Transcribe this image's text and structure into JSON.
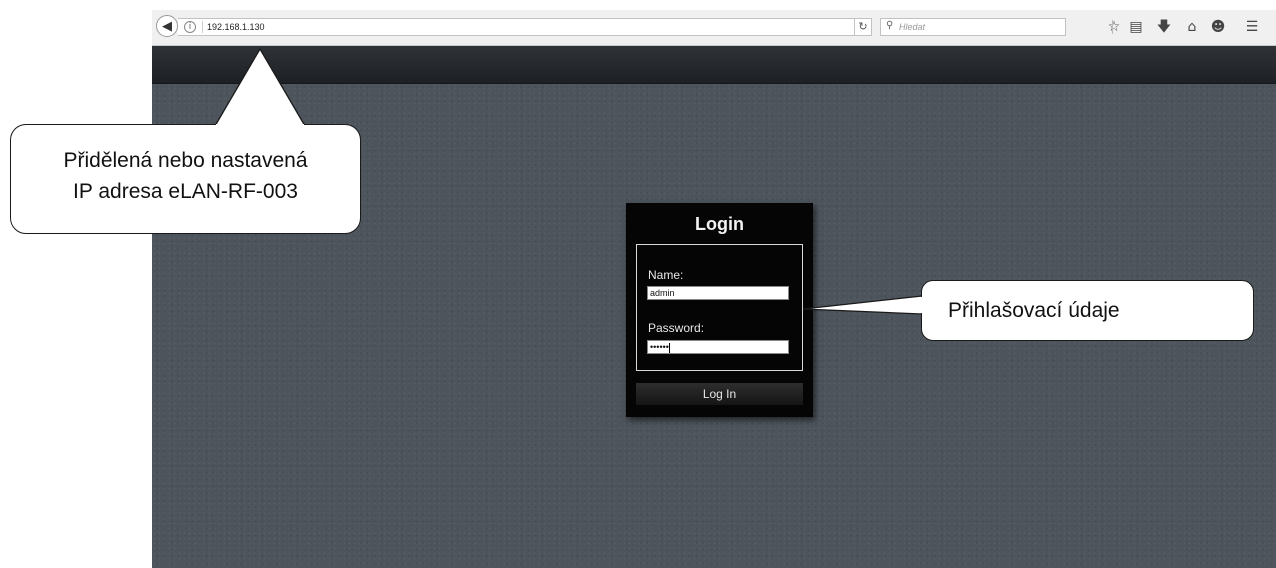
{
  "browser": {
    "url": "192.168.1.130",
    "search_placeholder": "Hledat",
    "icons": {
      "back": "back-arrow-icon",
      "info": "info-icon",
      "reload": "reload-icon",
      "search": "search-icon",
      "toolbar": [
        "star-icon",
        "reading-list-icon",
        "download-icon",
        "home-icon",
        "chat-icon",
        "menu-icon"
      ]
    }
  },
  "login": {
    "title": "Login",
    "name_label": "Name:",
    "name_value": "admin",
    "password_label": "Password:",
    "password_value": "••••••",
    "button_label": "Log In"
  },
  "callouts": {
    "ip": {
      "line1": "Přidělená nebo nastavená",
      "line2": "IP adresa eLAN-RF-003"
    },
    "credentials": "Přihlašovací údaje"
  },
  "colors": {
    "page_background": "#4d545c",
    "header_bar": "#1d2024",
    "dialog_background": "#050505"
  }
}
